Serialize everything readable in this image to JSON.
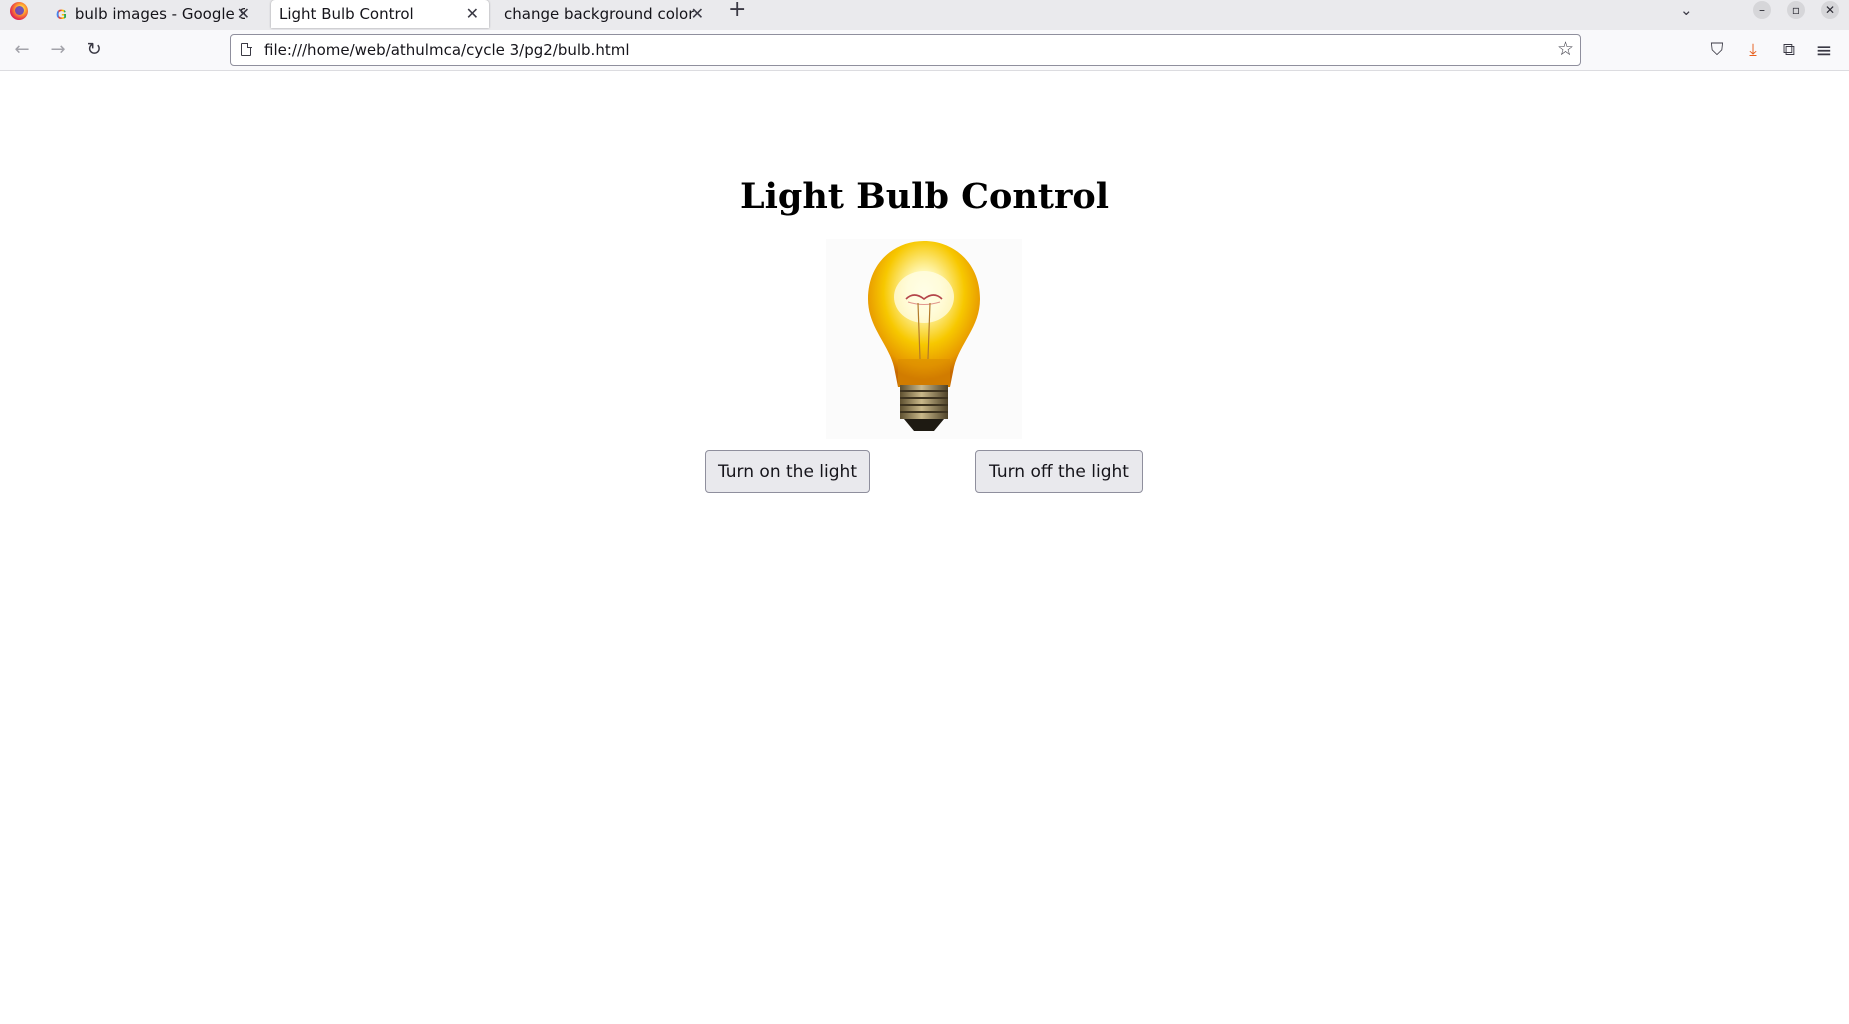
{
  "browser": {
    "tabs": [
      {
        "label": "bulb images - Google Sea",
        "favicon": "G",
        "active": false
      },
      {
        "label": "Light Bulb Control",
        "active": true
      },
      {
        "label": "change background color",
        "active": false
      }
    ],
    "new_tab_symbol": "+",
    "list_tabs_symbol": "⌄",
    "window_controls": {
      "minimize": "–",
      "maximize": "▫",
      "close": "✕"
    },
    "close_symbol": "✕",
    "url": "file:///home/web/athulmca/cycle 3/pg2/bulb.html",
    "icons": {
      "back": "←",
      "forward": "→",
      "reload": "↻",
      "star": "☆",
      "pocket": "⛉",
      "download": "⤓",
      "extensions": "⧉",
      "menu": "≡"
    }
  },
  "page": {
    "title": "Light Bulb Control",
    "bulb_state": "on",
    "buttons": {
      "turn_on": "Turn on the light",
      "turn_off": "Turn off the light"
    }
  },
  "colors": {
    "bulb_glass": "#f7c800",
    "bulb_glow": "#fff6b0",
    "bulb_base": "#8a7a55",
    "download_accent": "#e7601e"
  }
}
